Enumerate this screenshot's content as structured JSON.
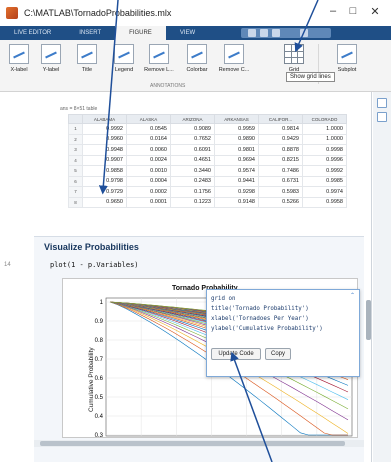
{
  "window": {
    "title": "C:\\MATLAB\\TornadoProbabilities.mlx",
    "min": "–",
    "max": "□",
    "close": "✕"
  },
  "tabs": [
    "LIVE EDITOR",
    "INSERT",
    "FIGURE",
    "VIEW"
  ],
  "active_tab": "FIGURE",
  "ribbon": {
    "buttons": [
      "X-label",
      "Y-label",
      "Title",
      "Legend",
      "Remove L...",
      "Colorbar",
      "Remove C...",
      "Grid",
      "Subplot"
    ],
    "group_label": "ANNOTATIONS",
    "tooltip": "Show grid lines"
  },
  "table": {
    "var_label": "ans = 8×51 table",
    "columns": [
      "ALABAMA",
      "ALASKA",
      "ARIZONA",
      "ARKANSAS",
      "CALIFOR...",
      "COLORADO"
    ],
    "rows": [
      [
        "1",
        "0.9992",
        "0.0545",
        "0.9089",
        "0.9959",
        "0.9814",
        "1.0000"
      ],
      [
        "2",
        "0.9960",
        "0.0164",
        "0.7652",
        "0.9890",
        "0.9429",
        "1.0000"
      ],
      [
        "3",
        "0.9948",
        "0.0060",
        "0.6091",
        "0.9801",
        "0.8878",
        "0.9998"
      ],
      [
        "4",
        "0.9907",
        "0.0024",
        "0.4651",
        "0.9694",
        "0.8215",
        "0.9996"
      ],
      [
        "5",
        "0.9858",
        "0.0010",
        "0.3440",
        "0.9574",
        "0.7486",
        "0.9992"
      ],
      [
        "6",
        "0.9798",
        "0.0004",
        "0.2483",
        "0.9441",
        "0.6731",
        "0.9985"
      ],
      [
        "7",
        "0.9729",
        "0.0002",
        "0.1756",
        "0.9298",
        "0.5983",
        "0.9974"
      ],
      [
        "8",
        "0.9650",
        "0.0001",
        "0.1223",
        "0.9148",
        "0.5266",
        "0.9958"
      ]
    ]
  },
  "section": {
    "title": "Visualize Probabilities",
    "line_number": "14",
    "code": "plot(1 - p.Variables)"
  },
  "figure": {
    "title": "Tornado Probability",
    "ylabel": "Cumulative Probability",
    "yticks": [
      "1",
      "0.9",
      "0.8",
      "0.7",
      "0.6",
      "0.5",
      "0.4",
      "0.3"
    ]
  },
  "popup": {
    "lines": [
      "grid on",
      "title('Tornado Probability')",
      "xlabel('Tornadoes Per Year')",
      "ylabel('Cumulative Probability')"
    ],
    "update_button": "Update Code",
    "copy_button": "Copy"
  },
  "colors": {
    "ribbon_tab_bar": "#1f4f86",
    "section_title": "#17365d",
    "popup_border": "#7fa9d8"
  }
}
